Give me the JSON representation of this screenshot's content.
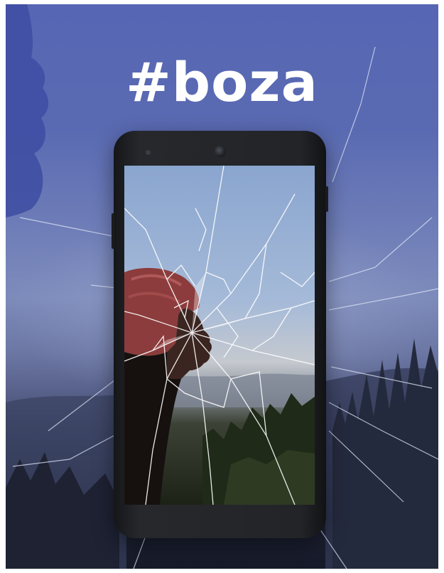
{
  "poster": {
    "title": "#boza"
  },
  "colors": {
    "sky_top": "#5666b4",
    "sky_mid": "#7d8bbb",
    "ground": "#161a29",
    "phone_body": "#222428",
    "title_text": "#ffffff"
  }
}
